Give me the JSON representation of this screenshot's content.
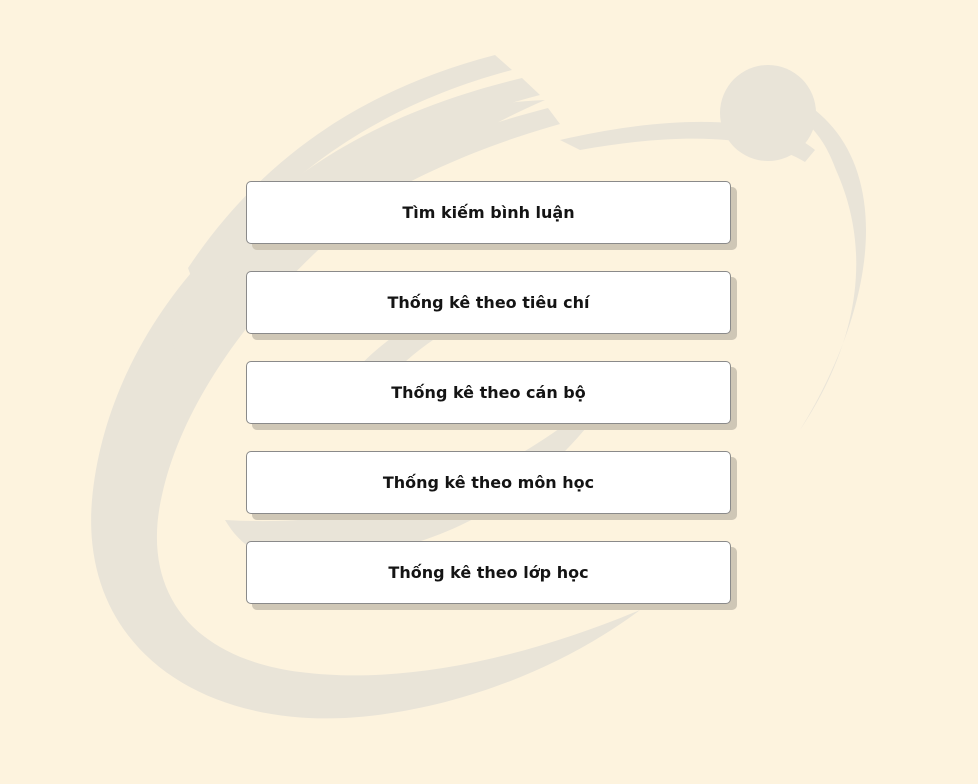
{
  "menu": {
    "items": [
      {
        "label": "Tìm kiếm bình luận"
      },
      {
        "label": "Thống kê theo tiêu chí"
      },
      {
        "label": "Thống kê theo cán bộ"
      },
      {
        "label": "Thống kê theo môn học"
      },
      {
        "label": "Thống kê theo lớp học"
      }
    ]
  },
  "colors": {
    "background": "#fdf3de",
    "watermark": "#e9e4d8",
    "button_background": "#ffffff",
    "button_shadow": "#cfc7b6",
    "text": "#141414"
  },
  "watermark": {
    "icon": "orbit-logo-watermark"
  }
}
